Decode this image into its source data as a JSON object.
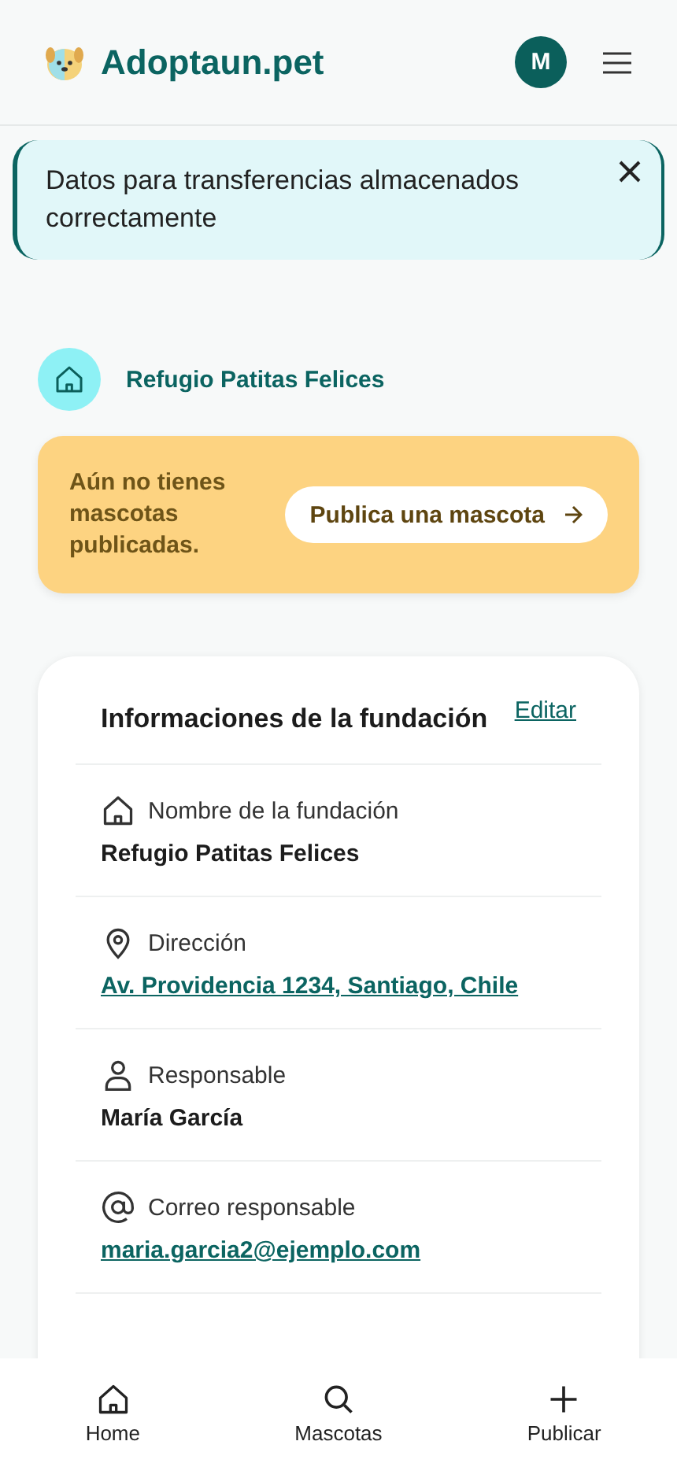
{
  "header": {
    "brand": "Adoptaun.pet",
    "avatar": "M"
  },
  "alert": {
    "message": "Datos para transferencias almacenados correctamente"
  },
  "organization": {
    "name": "Refugio Patitas Felices"
  },
  "empty_state": {
    "message": "Aún no tienes mascotas publicadas.",
    "button": "Publica una mascota"
  },
  "info_card": {
    "title": "Informaciones de la fundación",
    "edit_link": "Editar",
    "fields": [
      {
        "kind": "home",
        "label": "Nombre de la fundación",
        "value": "Refugio Patitas Felices",
        "link": false
      },
      {
        "kind": "pin",
        "label": "Dirección",
        "value": "Av. Providencia 1234, Santiago, Chile",
        "link": true
      },
      {
        "kind": "person",
        "label": "Responsable",
        "value": "María García",
        "link": false
      },
      {
        "kind": "at",
        "label": "Correo responsable",
        "value": "maria.garcia2@ejemplo.com",
        "link": true
      }
    ]
  },
  "bottom_nav": [
    {
      "kind": "home",
      "label": "Home"
    },
    {
      "kind": "search",
      "label": "Mascotas"
    },
    {
      "kind": "plus",
      "label": "Publicar"
    }
  ]
}
